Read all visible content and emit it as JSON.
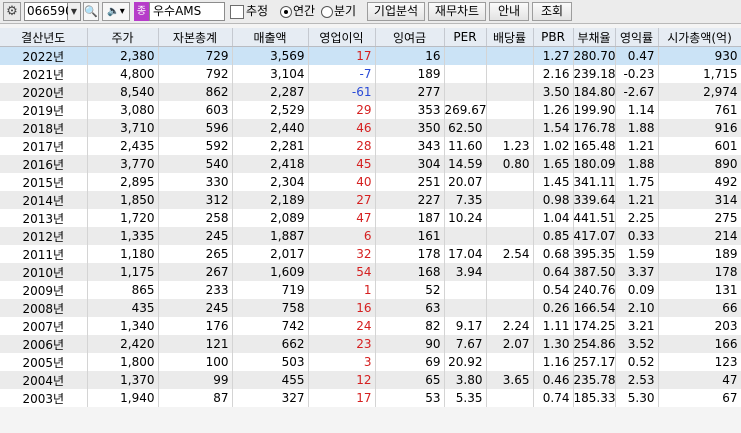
{
  "toolbar": {
    "code": "066590",
    "badge": "종",
    "name": "우수AMS",
    "chk_label": "추정",
    "radio_annual": "연간",
    "radio_quarter": "분기",
    "buttons": [
      "기업분석",
      "재무차트",
      "안내",
      "조회"
    ]
  },
  "table": {
    "headers": [
      "결산년도",
      "주가",
      "자본총계",
      "매출액",
      "영업이익",
      "잉여금",
      "PER",
      "배당률",
      "PBR",
      "부채율",
      "영익률",
      "시가총액(억)"
    ],
    "rows": [
      [
        "2022년",
        "2,380",
        "729",
        "3,569",
        "17",
        "16",
        "",
        "",
        "1.27",
        "280.70",
        "0.47",
        "930"
      ],
      [
        "2021년",
        "4,800",
        "792",
        "3,104",
        "-7",
        "189",
        "",
        "",
        "2.16",
        "239.18",
        "-0.23",
        "1,715"
      ],
      [
        "2020년",
        "8,540",
        "862",
        "2,287",
        "-61",
        "277",
        "",
        "",
        "3.50",
        "184.80",
        "-2.67",
        "2,974"
      ],
      [
        "2019년",
        "3,080",
        "603",
        "2,529",
        "29",
        "353",
        "269.67",
        "",
        "1.26",
        "199.90",
        "1.14",
        "761"
      ],
      [
        "2018년",
        "3,710",
        "596",
        "2,440",
        "46",
        "350",
        "62.50",
        "",
        "1.54",
        "176.78",
        "1.88",
        "916"
      ],
      [
        "2017년",
        "2,435",
        "592",
        "2,281",
        "28",
        "343",
        "11.60",
        "1.23",
        "1.02",
        "165.48",
        "1.21",
        "601"
      ],
      [
        "2016년",
        "3,770",
        "540",
        "2,418",
        "45",
        "304",
        "14.59",
        "0.80",
        "1.65",
        "180.09",
        "1.88",
        "890"
      ],
      [
        "2015년",
        "2,895",
        "330",
        "2,304",
        "40",
        "251",
        "20.07",
        "",
        "1.45",
        "341.11",
        "1.75",
        "492"
      ],
      [
        "2014년",
        "1,850",
        "312",
        "2,189",
        "27",
        "227",
        "7.35",
        "",
        "0.98",
        "339.64",
        "1.21",
        "314"
      ],
      [
        "2013년",
        "1,720",
        "258",
        "2,089",
        "47",
        "187",
        "10.24",
        "",
        "1.04",
        "441.51",
        "2.25",
        "275"
      ],
      [
        "2012년",
        "1,335",
        "245",
        "1,887",
        "6",
        "161",
        "",
        "",
        "0.85",
        "417.07",
        "0.33",
        "214"
      ],
      [
        "2011년",
        "1,180",
        "265",
        "2,017",
        "32",
        "178",
        "17.04",
        "2.54",
        "0.68",
        "395.35",
        "1.59",
        "189"
      ],
      [
        "2010년",
        "1,175",
        "267",
        "1,609",
        "54",
        "168",
        "3.94",
        "",
        "0.64",
        "387.50",
        "3.37",
        "178"
      ],
      [
        "2009년",
        "865",
        "233",
        "719",
        "1",
        "52",
        "",
        "",
        "0.54",
        "240.76",
        "0.09",
        "131"
      ],
      [
        "2008년",
        "435",
        "245",
        "758",
        "16",
        "63",
        "",
        "",
        "0.26",
        "166.54",
        "2.10",
        "66"
      ],
      [
        "2007년",
        "1,340",
        "176",
        "742",
        "24",
        "82",
        "9.17",
        "2.24",
        "1.11",
        "174.25",
        "3.21",
        "203"
      ],
      [
        "2006년",
        "2,420",
        "121",
        "662",
        "23",
        "90",
        "7.67",
        "2.07",
        "1.30",
        "254.86",
        "3.52",
        "166"
      ],
      [
        "2005년",
        "1,800",
        "100",
        "503",
        "3",
        "69",
        "20.92",
        "",
        "1.16",
        "257.17",
        "0.52",
        "123"
      ],
      [
        "2004년",
        "1,370",
        "99",
        "455",
        "12",
        "65",
        "3.80",
        "3.65",
        "0.46",
        "235.78",
        "2.53",
        "47"
      ],
      [
        "2003년",
        "1,940",
        "87",
        "327",
        "17",
        "53",
        "5.35",
        "",
        "0.74",
        "185.33",
        "5.30",
        "67"
      ]
    ]
  }
}
